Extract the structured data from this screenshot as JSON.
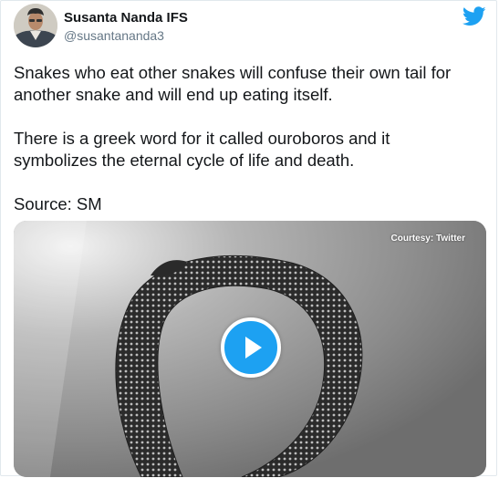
{
  "author": {
    "name": "Susanta Nanda IFS",
    "handle": "@susantananda3",
    "avatar_icon": "user-avatar"
  },
  "brand": {
    "icon": "twitter-bird-icon",
    "color": "#1da1f2"
  },
  "tweet": {
    "paragraphs": [
      "Snakes who eat other snakes will confuse their own tail for another snake and will end up eating itself.",
      "There is a greek word for it called ouroboros and it symbolizes the eternal cycle of life and death.",
      "Source: SM"
    ]
  },
  "media": {
    "courtesy": "Courtesy: Twitter",
    "play_icon": "play-icon"
  }
}
